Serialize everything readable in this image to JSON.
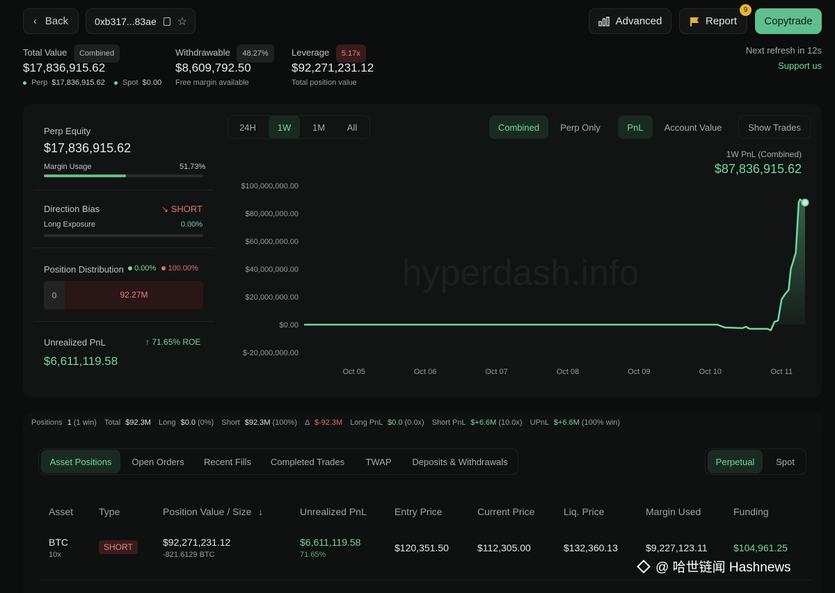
{
  "header": {
    "back_label": "Back",
    "address": "0xb317...83ae",
    "advanced_label": "Advanced",
    "report_label": "Report",
    "report_badge": "9",
    "copytrade_label": "Copytrade"
  },
  "summary": {
    "total_value_label": "Total Value",
    "total_value_pill": "Combined",
    "total_value": "$17,836,915.62",
    "perp_label": "Perp",
    "perp_value": "$17,836,915.62",
    "spot_label": "Spot",
    "spot_value": "$0.00",
    "withdrawable_label": "Withdrawable",
    "withdrawable_pill": "48.27%",
    "withdrawable_value": "$8,609,792.50",
    "withdrawable_sub": "Free margin available",
    "leverage_label": "Leverage",
    "leverage_pill": "5.17x",
    "leverage_value": "$92,271,231.12",
    "leverage_sub": "Total position value",
    "refresh_text": "Next refresh in 12s",
    "support_link": "Support us"
  },
  "left_panel": {
    "perp_equity_label": "Perp Equity",
    "perp_equity_value": "$17,836,915.62",
    "margin_usage_label": "Margin Usage",
    "margin_usage_value": "51.73%",
    "margin_usage_fraction": 0.5173,
    "direction_bias_label": "Direction Bias",
    "direction_bias_value": "SHORT",
    "long_exposure_label": "Long Exposure",
    "long_exposure_value": "0.00%",
    "position_dist_label": "Position Distribution",
    "long_pct": "0.00%",
    "short_pct": "100.00%",
    "dist_long_value": "0",
    "dist_short_value": "92.27M",
    "unrealized_label": "Unrealized PnL",
    "roe_text": "71.65% ROE",
    "unrealized_value": "$6,611,119.58"
  },
  "chart_controls": {
    "ranges": [
      "24H",
      "1W",
      "1M",
      "All"
    ],
    "active_range": "1W",
    "mode_combined": "Combined",
    "mode_perp": "Perp Only",
    "metric_pnl": "PnL",
    "metric_account": "Account Value",
    "show_trades": "Show Trades",
    "chart_label": "1W PnL (Combined)",
    "chart_value": "$87,836,915.62",
    "watermark": "hyperdash.info"
  },
  "chart_data": {
    "type": "area",
    "title": "1W PnL (Combined)",
    "ylim": [
      -20000000,
      100000000
    ],
    "y_ticks": [
      "$100,000,000.00",
      "$80,000,000.00",
      "$60,000,000.00",
      "$40,000,000.00",
      "$20,000,000.00",
      "$0.00",
      "$-20,000,000.00"
    ],
    "y_tick_values": [
      100000000,
      80000000,
      60000000,
      40000000,
      20000000,
      0,
      -20000000
    ],
    "x_ticks": [
      "Oct 05",
      "Oct 06",
      "Oct 07",
      "Oct 08",
      "Oct 09",
      "Oct 10",
      "Oct 11"
    ],
    "x_tick_days": [
      5,
      6,
      7,
      8,
      9,
      10,
      11
    ],
    "x_range_days": [
      4.3,
      11.33
    ],
    "series": [
      {
        "color": "#6fd7a4",
        "points": [
          [
            4.3,
            0
          ],
          [
            10.1,
            0
          ],
          [
            10.2,
            -2000000
          ],
          [
            10.45,
            -2500000
          ],
          [
            10.5,
            -1500000
          ],
          [
            10.55,
            -3000000
          ],
          [
            10.8,
            -3000000
          ],
          [
            10.85,
            -4000000
          ],
          [
            10.9,
            2000000
          ],
          [
            10.95,
            3000000
          ],
          [
            11.0,
            18000000
          ],
          [
            11.05,
            22000000
          ],
          [
            11.1,
            25000000
          ],
          [
            11.13,
            40000000
          ],
          [
            11.16,
            45000000
          ],
          [
            11.2,
            52000000
          ],
          [
            11.24,
            88000000
          ],
          [
            11.26,
            90000000
          ],
          [
            11.33,
            87836915.62
          ]
        ]
      }
    ]
  },
  "stats_bar": {
    "positions_label": "Positions",
    "positions_value": "1",
    "positions_sub": "(1 win)",
    "total_label": "Total",
    "total_value": "$92.3M",
    "long_label": "Long",
    "long_value": "$0.0",
    "long_sub": "(0%)",
    "short_label": "Short",
    "short_value": "$92.3M",
    "short_sub": "(100%)",
    "delta_label": "Δ",
    "delta_value": "$-92.3M",
    "long_pnl_label": "Long PnL",
    "long_pnl_value": "$0.0",
    "long_pnl_sub": "(0.0x)",
    "short_pnl_label": "Short PnL",
    "short_pnl_value": "$+6.6M",
    "short_pnl_sub": "(10.0x)",
    "upnl_label": "UPnL",
    "upnl_value": "$+6.6M",
    "upnl_sub": "(100% win)"
  },
  "bottom_tabs": {
    "tabs": [
      "Asset Positions",
      "Open Orders",
      "Recent Fills",
      "Completed Trades",
      "TWAP",
      "Deposits & Withdrawals"
    ],
    "perpetual": "Perpetual",
    "spot": "Spot"
  },
  "table": {
    "headers": [
      "Asset",
      "Type",
      "Position Value / Size",
      "Unrealized PnL",
      "Entry Price",
      "Current Price",
      "Liq. Price",
      "Margin Used",
      "Funding"
    ],
    "rows": [
      {
        "asset": "BTC",
        "leverage": "10x",
        "type": "SHORT",
        "position_value": "$92,271,231.12",
        "size": "-821.6129 BTC",
        "upnl": "$6,611,119.58",
        "upnl_pct": "71.65%",
        "entry": "$120,351.50",
        "current": "$112,305.00",
        "liq": "$132,360.13",
        "margin": "$9,227,123.11",
        "funding": "$104,961.25"
      }
    ]
  },
  "footer_watermark": "@ 哈世链闻 Hashnews"
}
